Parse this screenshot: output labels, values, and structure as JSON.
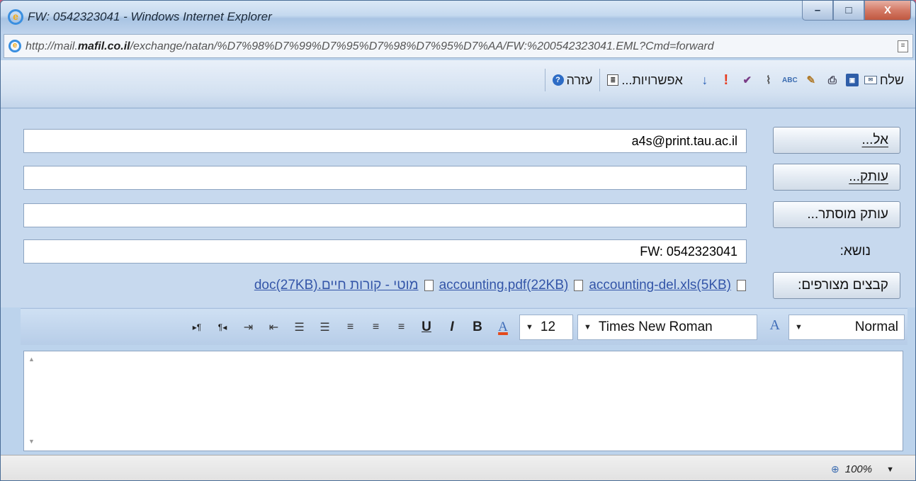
{
  "window": {
    "title": "FW: 0542323041 - Windows Internet Explorer",
    "url_prefix": "http://mail.",
    "url_host_bold": "mafil.co.il",
    "url_rest": "/exchange/natan/%D7%98%D7%99%D7%95%D7%98%D7%95%D7%AA/FW:%200542323041.EML?Cmd=forward",
    "min_label": "–",
    "max_label": "□",
    "close_label": "X"
  },
  "toolbar": {
    "send_label": "שלח",
    "options_label": "אפשרויות...",
    "help_label": "עזרה"
  },
  "form": {
    "to_label": "אל...",
    "to_value": "a4s@print.tau.ac.il",
    "cc_label": "עותק...",
    "cc_value": "",
    "bcc_label": "עותק מוסתר...",
    "bcc_value": "",
    "subject_label": "נושא:",
    "subject_value": "FW: 0542323041",
    "attachments_label": "קבצים מצורפים:",
    "attachments": [
      {
        "name": "accounting-del.xls(5KB)"
      },
      {
        "name": "accounting.pdf(22KB)"
      },
      {
        "name": "מוטי - קורות חיים.doc(27KB)"
      }
    ]
  },
  "format": {
    "style_value": "Normal",
    "font_value": "Times New Roman",
    "size_value": "12",
    "bold": "B",
    "italic": "I",
    "underline": "U",
    "font_color": "A"
  },
  "status": {
    "zoom": "100%"
  }
}
